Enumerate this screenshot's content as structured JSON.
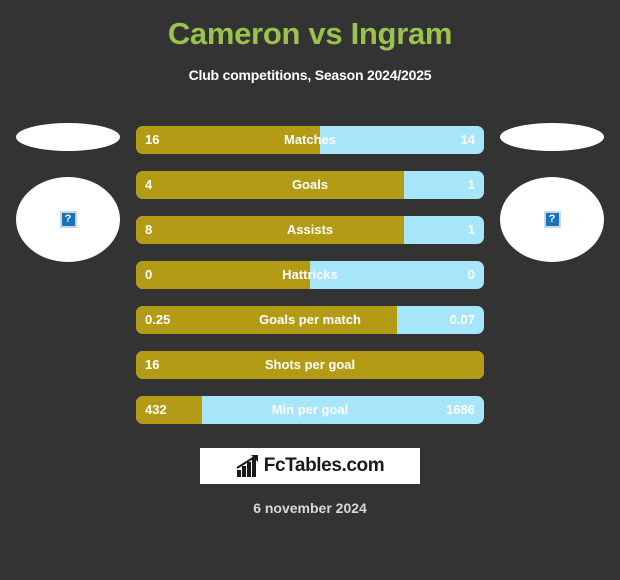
{
  "header": {
    "title": "Cameron vs Ingram",
    "subtitle": "Club competitions, Season 2024/2025",
    "title_color": "#9ac24c"
  },
  "players": {
    "left": {
      "photo_alt": "?",
      "photo_icon": "broken-image-icon"
    },
    "right": {
      "photo_alt": "?",
      "photo_icon": "broken-image-icon"
    }
  },
  "colors": {
    "home_bar": "#b39b16",
    "away_bar": "#a7e5fb",
    "background": "#333333"
  },
  "footer": {
    "logo_text": "FcTables.com",
    "logo_icon": "bar-chart-icon",
    "date": "6 november 2024"
  },
  "chart_data": {
    "type": "bar",
    "title": "Cameron vs Ingram",
    "subtitle": "Club competitions, Season 2024/2025",
    "xlabel": "",
    "ylabel": "",
    "orientation": "horizontal-diverging",
    "legend": [
      "Cameron",
      "Ingram"
    ],
    "categories": [
      "Matches",
      "Goals",
      "Assists",
      "Hattricks",
      "Goals per match",
      "Shots per goal",
      "Min per goal"
    ],
    "series": [
      {
        "name": "Cameron",
        "values": [
          "16",
          "4",
          "8",
          "0",
          "0.25",
          "16",
          "432"
        ]
      },
      {
        "name": "Ingram",
        "values": [
          "14",
          "1",
          "1",
          "0",
          "0.07",
          "",
          "1686"
        ]
      }
    ],
    "rows": [
      {
        "label": "Matches",
        "left": "16",
        "right": "14",
        "fill_percent": 53
      },
      {
        "label": "Goals",
        "left": "4",
        "right": "1",
        "fill_percent": 77
      },
      {
        "label": "Assists",
        "left": "8",
        "right": "1",
        "fill_percent": 77
      },
      {
        "label": "Hattricks",
        "left": "0",
        "right": "0",
        "fill_percent": 50
      },
      {
        "label": "Goals per match",
        "left": "0.25",
        "right": "0.07",
        "fill_percent": 75
      },
      {
        "label": "Shots per goal",
        "left": "16",
        "right": "",
        "fill_percent": 100
      },
      {
        "label": "Min per goal",
        "left": "432",
        "right": "1686",
        "fill_percent": 19
      }
    ]
  }
}
